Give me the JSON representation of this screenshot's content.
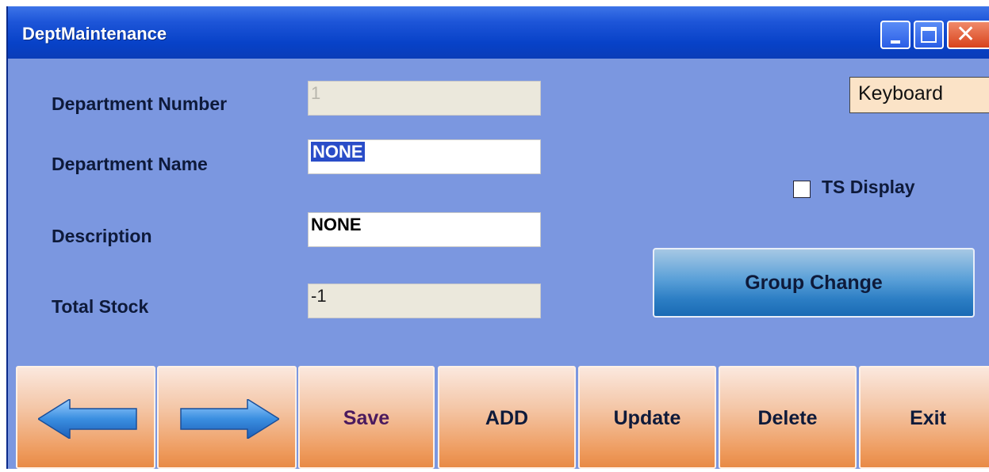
{
  "window": {
    "title": "DeptMaintenance",
    "controls": {
      "minimize": "minimize",
      "maximize": "maximize",
      "close": "close"
    }
  },
  "form": {
    "department_number": {
      "label": "Department Number",
      "value": "1"
    },
    "department_name": {
      "label": "Department Name",
      "value": "NONE"
    },
    "description": {
      "label": "Description",
      "value": "NONE"
    },
    "total_stock": {
      "label": "Total Stock",
      "value": "-1"
    }
  },
  "keyboard_button": "Keyboard",
  "ts_display": {
    "label": "TS Display",
    "checked": false
  },
  "group_change_button": "Group Change",
  "toolbar": {
    "prev_icon": "left-arrow-icon",
    "next_icon": "right-arrow-icon",
    "save": "Save",
    "add": "ADD",
    "update": "Update",
    "delete": "Delete",
    "exit": "Exit"
  },
  "colors": {
    "window_bg": "#7b97e0",
    "titlebar": "#0842c8",
    "button_orange": "#ee9a5c",
    "group_button_blue": "#2c7ec4",
    "arrow_blue": "#3a8ee0"
  }
}
